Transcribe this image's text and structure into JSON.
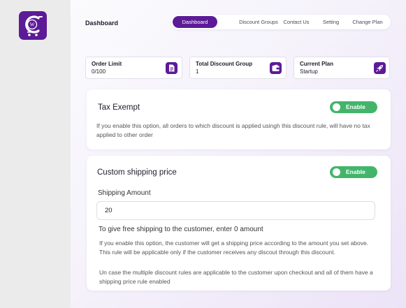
{
  "sidebar": {
    "logo_icon": "wp-cart-logo-icon"
  },
  "header": {
    "title": "Dashboard",
    "nav": [
      {
        "label": "Dashboard",
        "active": true
      },
      {
        "label": "Discount Groups",
        "active": false
      },
      {
        "label": "Contact Us",
        "active": false
      },
      {
        "label": "Setting",
        "active": false
      },
      {
        "label": "Change Plan",
        "active": false
      }
    ]
  },
  "stats": [
    {
      "label": "Order Limit",
      "value": "0/100",
      "icon": "document-icon"
    },
    {
      "label": "Total Discount Group",
      "value": "1",
      "icon": "wallet-icon"
    },
    {
      "label": "Current Plan",
      "value": "Startup",
      "icon": "rocket-icon"
    }
  ],
  "tax_exempt": {
    "title": "Tax Exempt",
    "toggle_label": "Enable",
    "enabled": true,
    "description": "If you enable this option, all orders to which discount is applied usingh this discount rule, will have no tax applied to other order"
  },
  "shipping": {
    "title": "Custom shipping price",
    "toggle_label": "Enable",
    "enabled": true,
    "amount_label": "Shipping Amount",
    "amount_value": "20",
    "help": "To give free shipping to the customer, enter 0 amount",
    "note_1": "If you enable this option, the customer will get a shipping price according to the amount you set above. This rule will be applicable only if the customer  receives any discout through this discount.",
    "note_2": "Un case the multiple discount rules are applicable to the customer upon checkout  and all of them have a shipping price rule enabled"
  },
  "colors": {
    "brand": "#5c1a97",
    "toggle_on": "#43b56b"
  }
}
